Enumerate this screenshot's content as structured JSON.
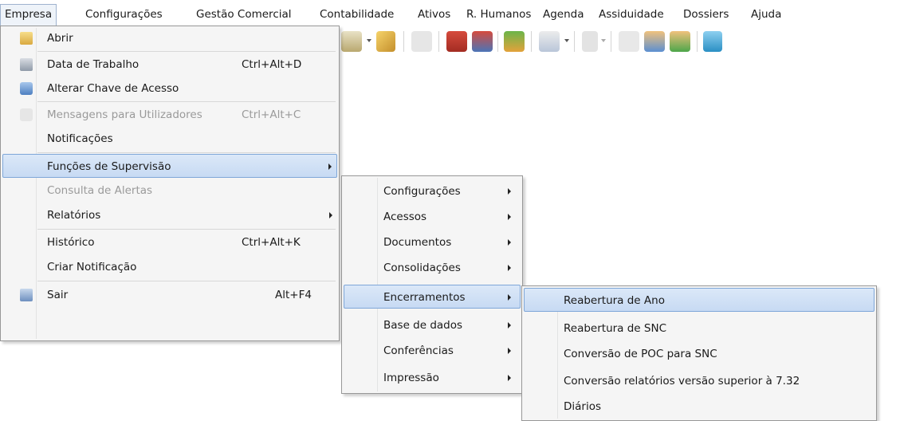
{
  "menubar": [
    "Empresa",
    "Configurações",
    "Gestão Comercial",
    "Contabilidade",
    "Ativos",
    "R. Humanos",
    "Agenda",
    "Assiduidade",
    "Dossiers",
    "Ajuda"
  ],
  "empresa_menu": [
    {
      "label": "Abrir",
      "shortcut": "",
      "icon": "folder-icon"
    },
    {
      "label": "Data de Trabalho",
      "shortcut": "Ctrl+Alt+D",
      "icon": "calendar-icon"
    },
    {
      "label": "Alterar Chave de Acesso",
      "shortcut": "",
      "icon": "key-icon"
    },
    {
      "label": "Mensagens para Utilizadores",
      "shortcut": "Ctrl+Alt+C",
      "icon": "message-icon"
    },
    {
      "label": "Notificações",
      "shortcut": ""
    },
    {
      "label": "Funções de Supervisão",
      "shortcut": ""
    },
    {
      "label": "Consulta de Alertas",
      "shortcut": ""
    },
    {
      "label": "Relatórios",
      "shortcut": ""
    },
    {
      "label": "Histórico",
      "shortcut": "Ctrl+Alt+K"
    },
    {
      "label": "Criar Notificação",
      "shortcut": ""
    },
    {
      "label": "Sair",
      "shortcut": "Alt+F4",
      "icon": "exit-icon"
    }
  ],
  "supervisao_menu": [
    "Configurações",
    "Acessos",
    "Documentos",
    "Consolidações",
    "Encerramentos",
    "Base de dados",
    "Conferências",
    "Impressão"
  ],
  "encerramentos_menu": [
    "Reabertura de Ano",
    "Reabertura de SNC",
    "Conversão de POC para SNC",
    "Conversão relatórios versão superior à 7.32",
    "Diários"
  ],
  "colors": {
    "highlight_top": "#dbe8f8",
    "highlight_bottom": "#c7daf3",
    "highlight_border": "#7ea6d8",
    "menu_bg": "#f5f5f5",
    "disabled": "#9a9a9a"
  }
}
